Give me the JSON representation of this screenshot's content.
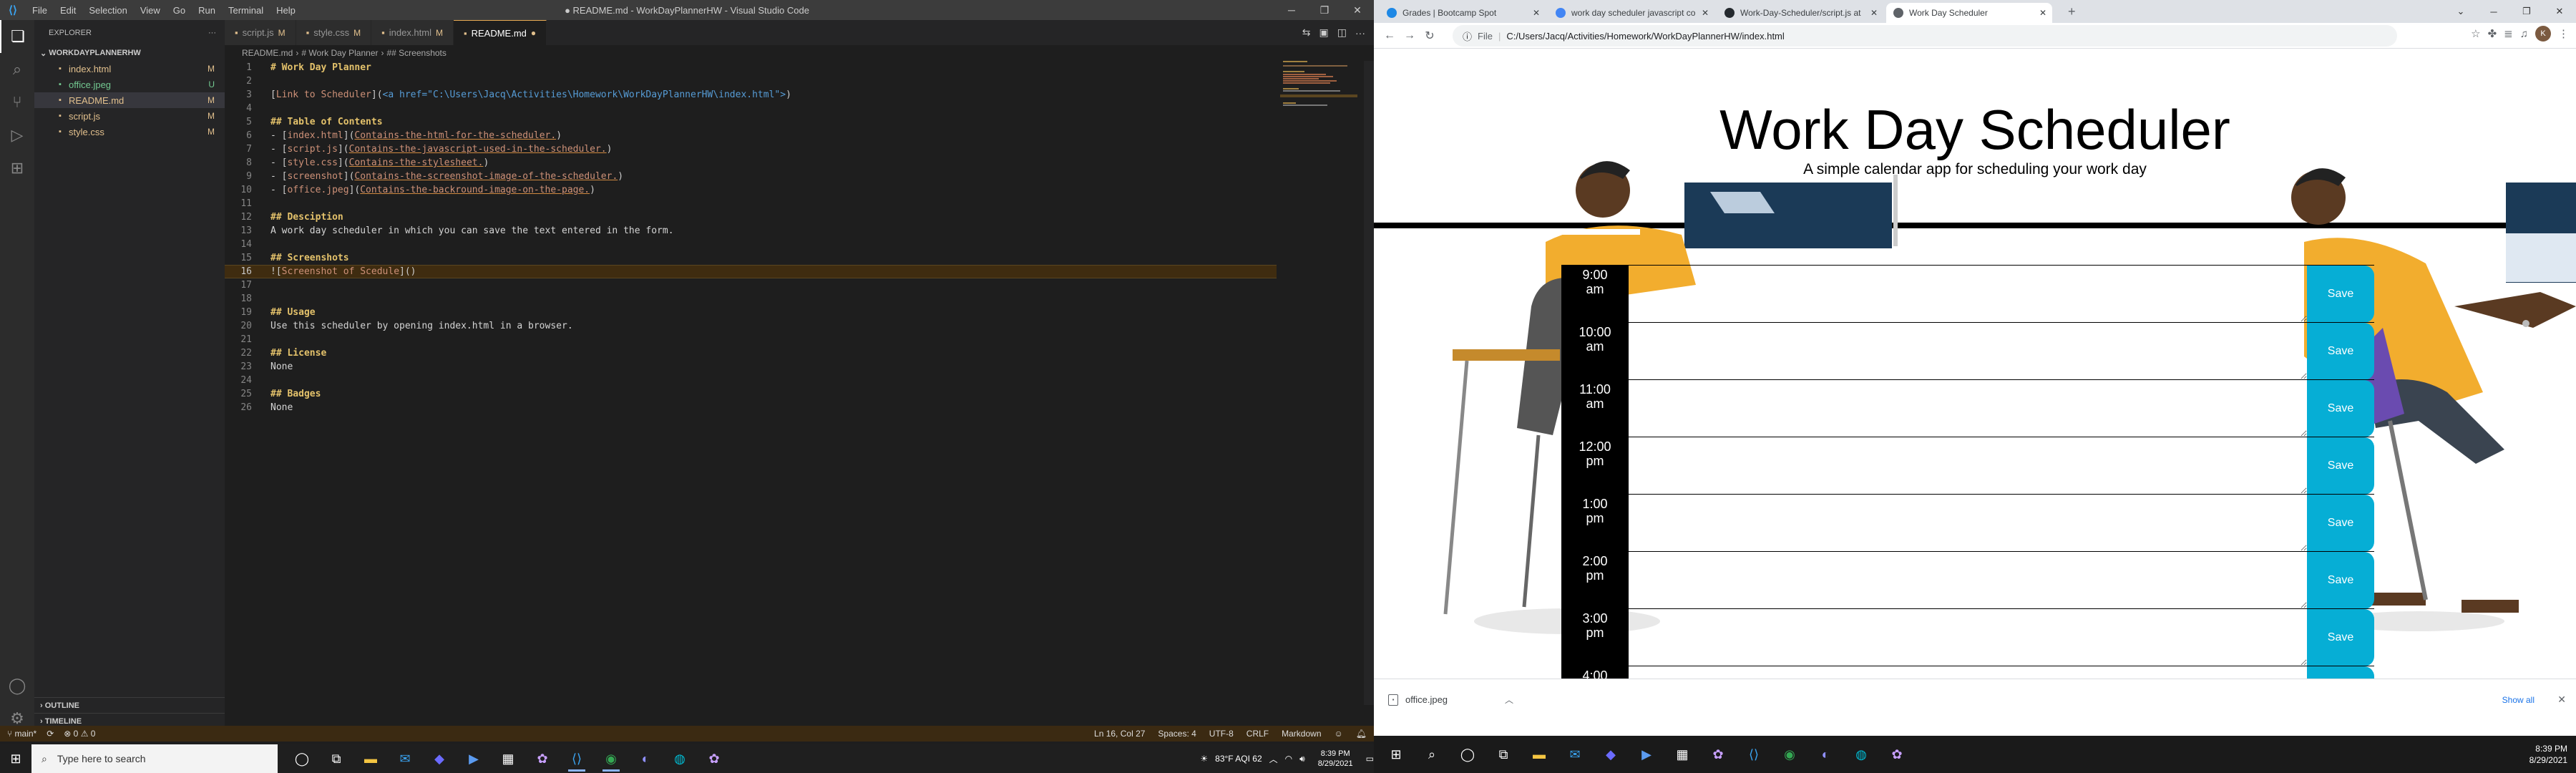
{
  "vscode": {
    "window_title": "● README.md - WorkDayPlannerHW - Visual Studio Code",
    "menu": [
      "File",
      "Edit",
      "Selection",
      "View",
      "Go",
      "Run",
      "Terminal",
      "Help"
    ],
    "explorer_label": "EXPLORER",
    "folder": "WORKDAYPLANNERHW",
    "files": [
      {
        "name": "index.html",
        "status": "M",
        "color": "#e2c08d",
        "icon": "html-file-icon"
      },
      {
        "name": "office.jpeg",
        "status": "U",
        "color": "#73c991",
        "icon": "image-file-icon"
      },
      {
        "name": "README.md",
        "status": "M",
        "color": "#e2c08d",
        "icon": "markdown-file-icon",
        "selected": true
      },
      {
        "name": "script.js",
        "status": "M",
        "color": "#e2c08d",
        "icon": "js-file-icon"
      },
      {
        "name": "style.css",
        "status": "M",
        "color": "#e2c08d",
        "icon": "css-file-icon"
      }
    ],
    "outline_label": "OUTLINE",
    "timeline_label": "TIMELINE",
    "tabs": [
      {
        "label": "script.js",
        "mark": "M",
        "active": false
      },
      {
        "label": "style.css",
        "mark": "M",
        "active": false
      },
      {
        "label": "index.html",
        "mark": "M",
        "active": false
      },
      {
        "label": "README.md",
        "mark": "●",
        "active": true
      }
    ],
    "breadcrumb": [
      "README.md",
      "# Work Day Planner",
      "## Screenshots"
    ],
    "code_lines": [
      "# Work Day Planner",
      "",
      "[Link to Scheduler](<a href=\"C:\\Users\\Jacq\\Activities\\Homework\\WorkDayPlannerHW\\index.html\">)",
      "",
      "## Table of Contents",
      "- [index.html](Contains-the-html-for-the-scheduler.)",
      "- [script.js](Contains-the-javascript-used-in-the-scheduler.)",
      "- [style.css](Contains-the-stylesheet.)",
      "- [screenshot](Contains-the-screenshot-image-of-the-scheduler.)",
      "- [office.jpeg](Contains-the-backround-image-on-the-page.)",
      "",
      "## Desciption",
      "A work day scheduler in which you can save the text entered in the form.",
      "",
      "## Screenshots",
      "![Screenshot of Scedule]()",
      "",
      "",
      "## Usage",
      "Use this scheduler by opening index.html in a browser.",
      "",
      "## License",
      "None",
      "",
      "## Badges",
      "None"
    ],
    "current_line": 16,
    "status": {
      "branch": "main*",
      "sync": "⟳",
      "problems": "⊗ 0 ⚠ 0",
      "position": "Ln 16, Col 27",
      "spaces": "Spaces: 4",
      "encoding": "UTF-8",
      "eol": "CRLF",
      "language": "Markdown"
    },
    "accent": "#3b2a12"
  },
  "chrome": {
    "tabs": [
      {
        "label": "Grades | Bootcamp Spot",
        "fav": "#1e88e5"
      },
      {
        "label": "work day scheduler javascript co",
        "fav": "#4285f4"
      },
      {
        "label": "Work-Day-Scheduler/script.js at",
        "fav": "#24292e"
      },
      {
        "label": "Work Day Scheduler",
        "fav": "#5f6368",
        "active": true
      }
    ],
    "url_scheme": "File",
    "url": "C:/Users/Jacq/Activities/Homework/WorkDayPlannerHW/index.html",
    "page": {
      "title": "Work Day Scheduler",
      "subtitle": "A simple calendar app for scheduling your work day",
      "hours": [
        "9:00\nam",
        "10:00\nam",
        "11:00\nam",
        "12:00\npm",
        "1:00\npm",
        "2:00\npm",
        "3:00\npm",
        "4:00"
      ],
      "save_label": "Save",
      "save_color": "#06aed5"
    },
    "download": {
      "file": "office.jpeg",
      "show_all": "Show all"
    }
  },
  "taskbar_left": {
    "search_placeholder": "Type here to search",
    "weather": "83°F  AQI 62",
    "time": "8:39 PM",
    "date": "8/29/2021"
  },
  "taskbar_right": {
    "time": "8:39 PM",
    "date": "8/29/2021"
  }
}
